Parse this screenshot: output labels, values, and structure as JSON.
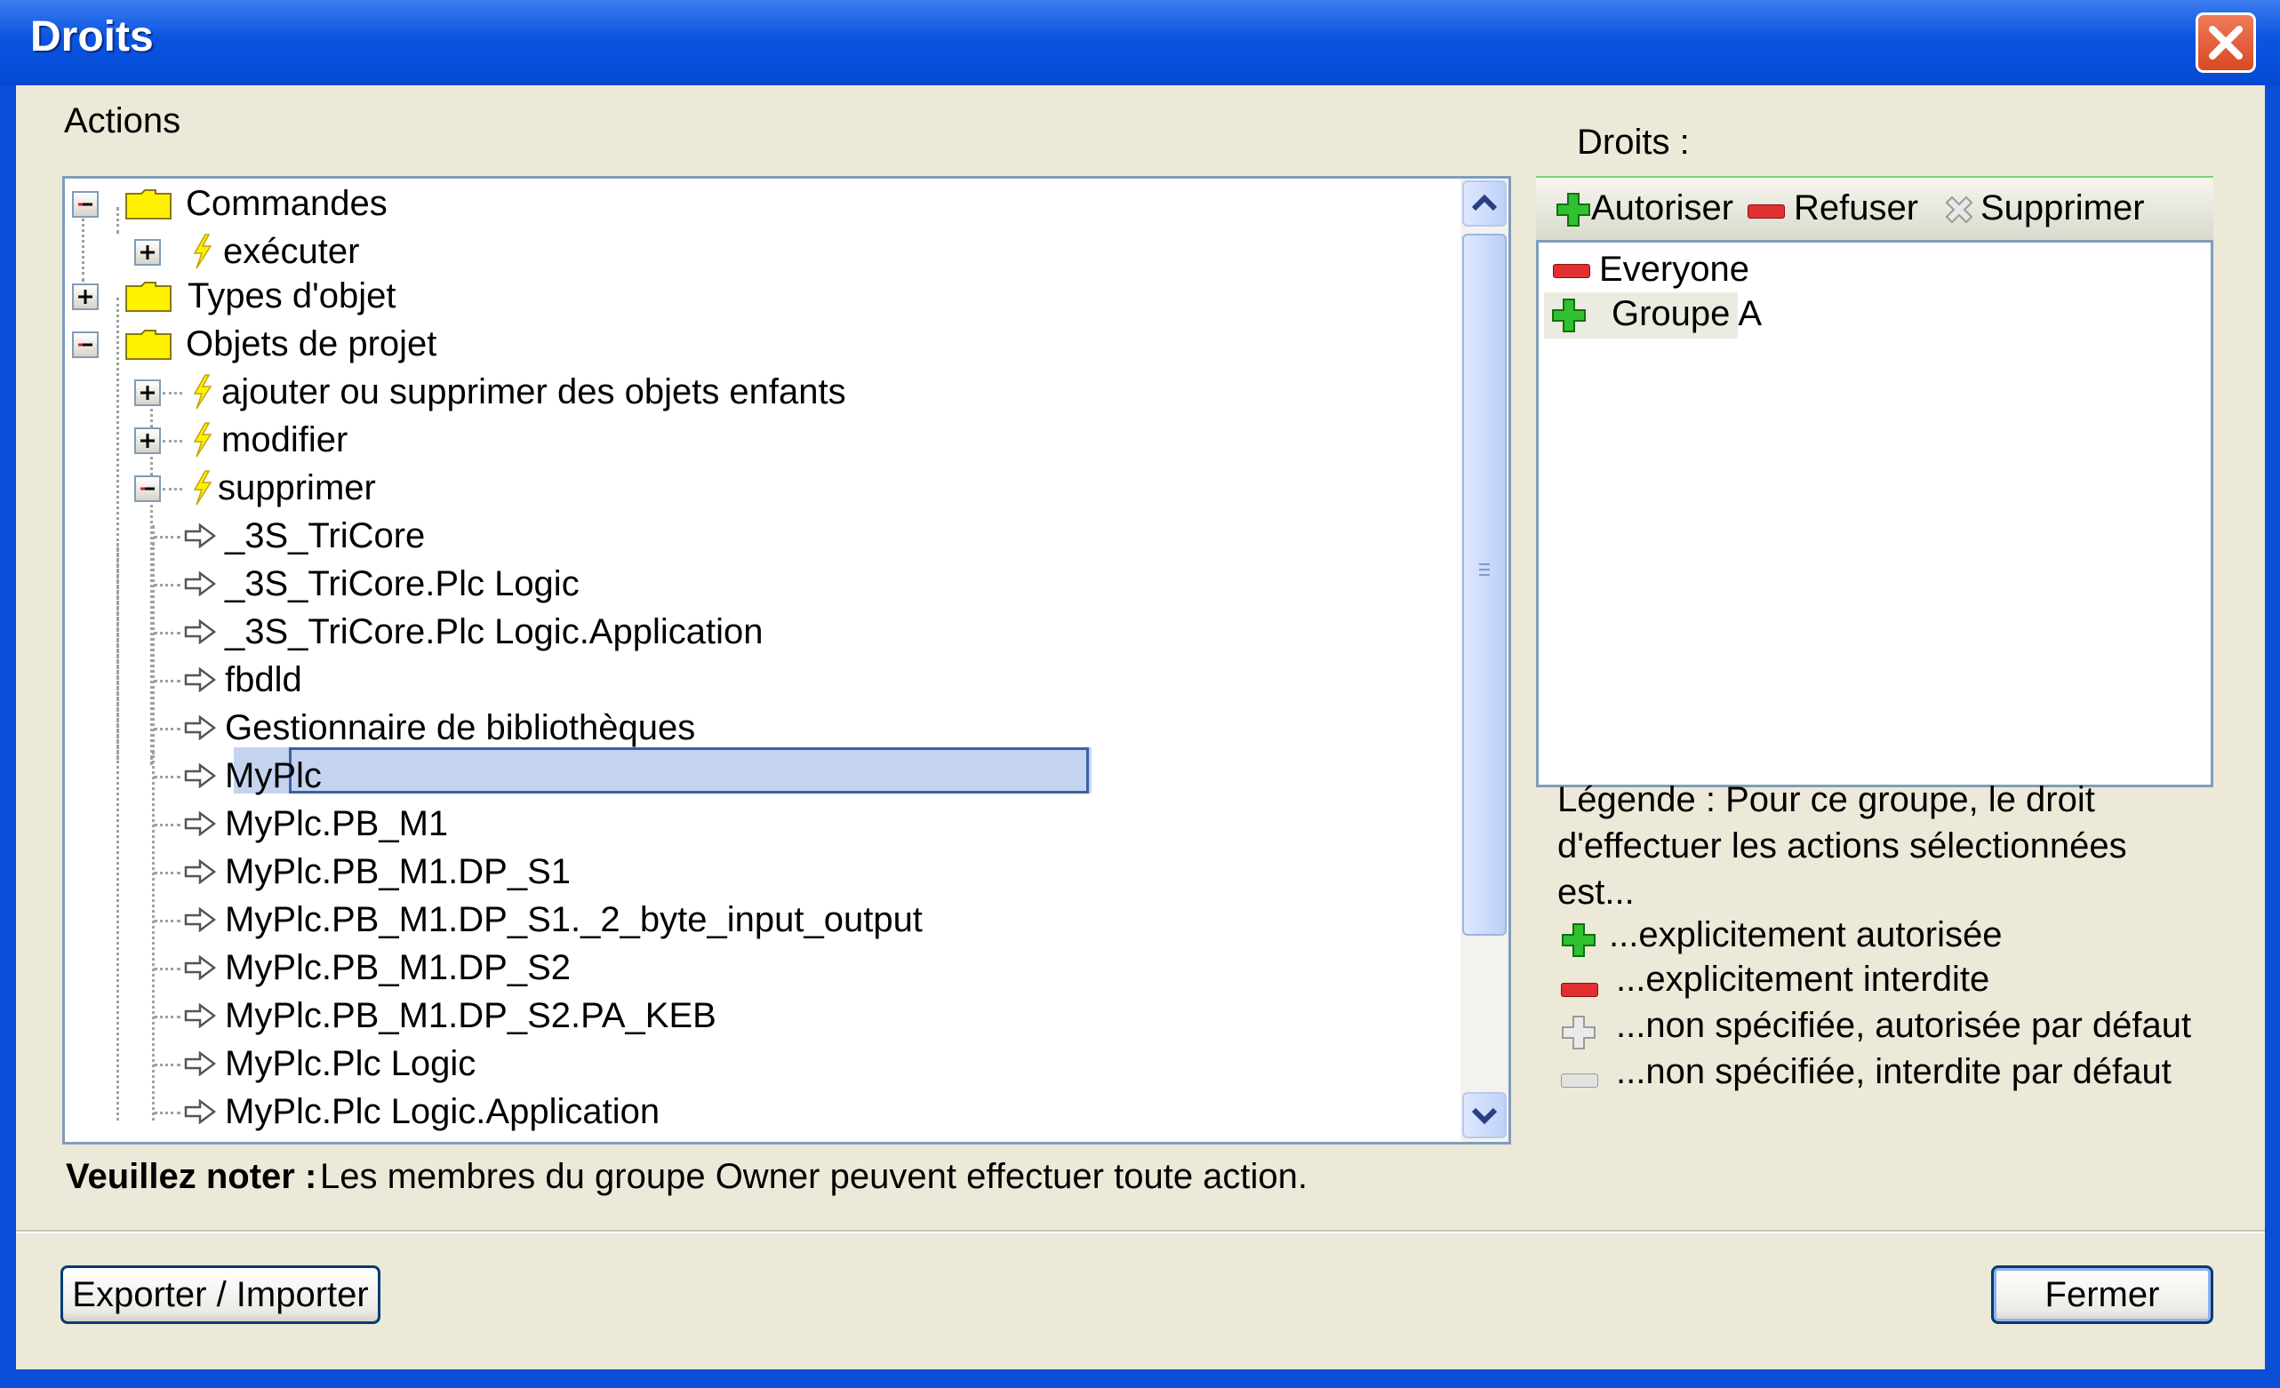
{
  "window": {
    "title": "Droits"
  },
  "actions": {
    "label": "Actions",
    "tree": {
      "commandes": "Commandes",
      "executer": "exécuter",
      "types_objet": "Types d'objet",
      "objets_projet": "Objets de projet",
      "ajouter": "ajouter ou supprimer des objets enfants",
      "modifier": "modifier",
      "supprimer": "supprimer",
      "children": [
        "_3S_TriCore",
        "_3S_TriCore.Plc Logic",
        "_3S_TriCore.Plc Logic.Application",
        "fbdld",
        "Gestionnaire de bibliothèques",
        "MyPlc",
        "MyPlc.PB_M1",
        "MyPlc.PB_M1.DP_S1",
        "MyPlc.PB_M1.DP_S1._2_byte_input_output",
        "MyPlc.PB_M1.DP_S2",
        "MyPlc.PB_M1.DP_S2.PA_KEB",
        "MyPlc.Plc Logic",
        "MyPlc.Plc Logic.Application"
      ],
      "selected": "MyPlc"
    }
  },
  "rights": {
    "label": "Droits :",
    "toolbar": {
      "allow": "Autoriser",
      "deny": "Refuser",
      "remove": "Supprimer"
    },
    "list": [
      {
        "name": "Everyone",
        "state": "deny"
      },
      {
        "name": "Groupe A",
        "state": "allow"
      }
    ]
  },
  "legend": {
    "intro": [
      "Légende : Pour ce groupe, le droit",
      "d'effectuer les actions sélectionnées",
      "est..."
    ],
    "items": [
      "...explicitement autorisée",
      "...explicitement interdite",
      "...non spécifiée, autorisée par défaut",
      "...non spécifiée, interdite par défaut"
    ]
  },
  "note": {
    "label": "Veuillez noter :",
    "text": "Les membres du groupe Owner peuvent effectuer toute action."
  },
  "buttons": {
    "export_import": "Exporter / Importer",
    "close": "Fermer"
  },
  "colors": {
    "titlebar": "#0349d4",
    "dialog_bg": "#ece9d8",
    "allow": "#22b022",
    "deny": "#e03030",
    "selection": "#c4d4ee"
  }
}
